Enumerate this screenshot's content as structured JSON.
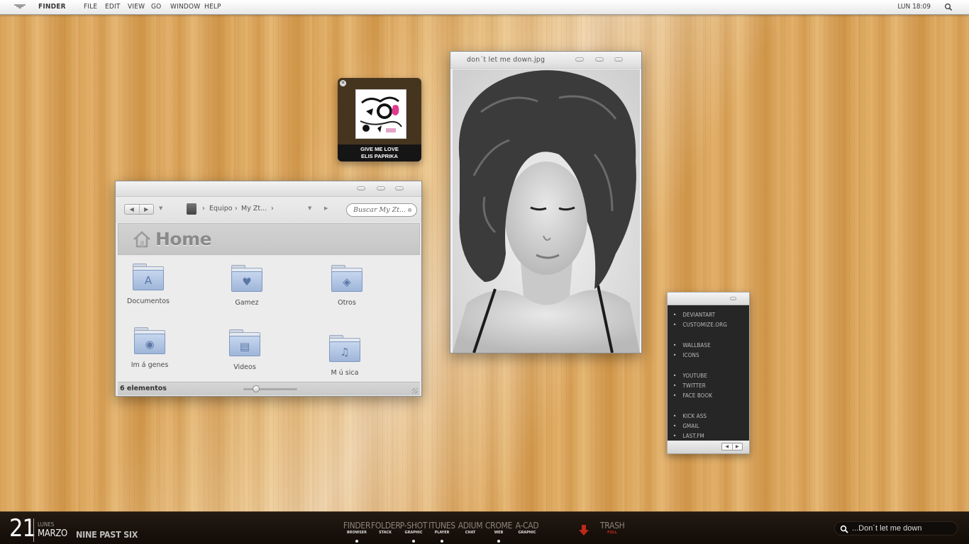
{
  "menubar": {
    "app": "FINDER",
    "items": [
      "FILE",
      "EDIT",
      "VIEW",
      "GO",
      "WINDOW",
      "HELP"
    ],
    "clock": "LUN 18:09"
  },
  "music_widget": {
    "song": "GIVE ME LOVE",
    "artist": "ELIS PAPRIKA"
  },
  "finder": {
    "breadcrumb": [
      "Equipo",
      "My Zt..."
    ],
    "search_placeholder": "Buscar My Zt...",
    "title": "Home",
    "items": [
      {
        "label": "Documentos",
        "icon": "applications-icon"
      },
      {
        "label": "Gamez",
        "icon": "heart-icon"
      },
      {
        "label": "Otros",
        "icon": "dropbox-icon"
      },
      {
        "label": "Im á genes",
        "icon": "camera-icon"
      },
      {
        "label": "Videos",
        "icon": "film-icon"
      },
      {
        "label": "M ú sica",
        "icon": "music-note-icon"
      }
    ],
    "status": "6  elementos",
    "zoom_level": 0.2
  },
  "viewer": {
    "title": "don´t let me down.jpg"
  },
  "links": {
    "groups": [
      [
        "DEVIANTART",
        "CUSTOMIZE.ORG"
      ],
      [
        "WALLBASE",
        "ICONS"
      ],
      [
        "YOUTUBE",
        "TWITTER",
        "FACE BOOK"
      ],
      [
        "KICK ASS",
        "GMAIL",
        "LAST.FM"
      ]
    ]
  },
  "dock": {
    "day": "21",
    "weekday": "LUNES",
    "month": "MARZO",
    "time_text": "NINE PAST SIX",
    "apps": [
      {
        "name": "FINDER",
        "sub": "BROWSER",
        "running": true
      },
      {
        "name": "FOLDER",
        "sub": "STACK",
        "running": false
      },
      {
        "name": "P-SHOT",
        "sub": "GRAPHIC",
        "running": true
      },
      {
        "name": "ITUNES",
        "sub": "PLAYER",
        "running": true
      },
      {
        "name": "ADIUM",
        "sub": "CHAT",
        "running": false
      },
      {
        "name": "CROME",
        "sub": "WEB",
        "running": true
      },
      {
        "name": "A-CAD",
        "sub": "GRAPHIC",
        "running": false
      }
    ],
    "trash": {
      "name": "TRASH",
      "sub": "FULL"
    },
    "search_text": "...Don´t let me down",
    "accent": "#c0281c"
  }
}
